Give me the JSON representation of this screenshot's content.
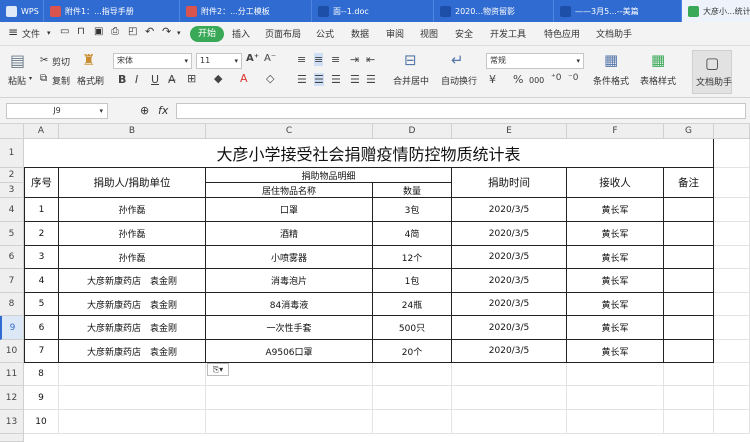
{
  "tabs": [
    {
      "label": "WPS",
      "color": "#ffffff"
    },
    {
      "label": "附件1：...指导手册",
      "color": "#d9534f"
    },
    {
      "label": "附件2：...分工模板",
      "color": "#d9534f"
    },
    {
      "label": "面--1.doc",
      "color": "#2f6bd0"
    },
    {
      "label": "2020...物资留影",
      "color": "#2f6bd0"
    },
    {
      "label": "——3月5...--美篇",
      "color": "#2f6bd0"
    },
    {
      "label": "大彦小...统计",
      "color": "#3aa957"
    }
  ],
  "menu": {
    "file": "文件",
    "items": [
      "开始",
      "插入",
      "页面布局",
      "公式",
      "数据",
      "审阅",
      "视图",
      "安全",
      "开发工具",
      "特色应用",
      "文档助手"
    ]
  },
  "toolbar": {
    "paste": "粘贴",
    "cut": "剪切",
    "copy": "复制",
    "format_painter": "格式刷",
    "font_name": "宋体",
    "font_size": "11",
    "merge_center": "合并居中",
    "wrap_text": "自动换行",
    "number_format": "常规",
    "percent": "%",
    "thousands": "000",
    "conditional_format": "条件格式",
    "table_style": "表格样式",
    "doc_assistant": "文档助手"
  },
  "formula_bar": {
    "cell_ref": "J9",
    "fx": "fx",
    "value": ""
  },
  "columns": [
    "A",
    "B",
    "C",
    "D",
    "E",
    "F",
    "G"
  ],
  "rows": [
    "1",
    "2",
    "3",
    "4",
    "5",
    "6",
    "7",
    "8",
    "9",
    "10",
    "11",
    "12",
    "13"
  ],
  "selected_row": "9",
  "sheet": {
    "title": "大彦小学接受社会捐赠疫情防控物质统计表",
    "h_no": "序号",
    "h_donor": "捐助人/捐助单位",
    "h_detail": "捐助物品明细",
    "h_item": "居住物品名称",
    "h_qty": "数量",
    "h_time": "捐助时间",
    "h_receiver": "接收人",
    "h_note": "备注",
    "data": [
      [
        "1",
        "孙作磊",
        "口罩",
        "3包",
        "2020/3/5",
        "黄长军"
      ],
      [
        "2",
        "孙作磊",
        "酒精",
        "4简",
        "2020/3/5",
        "黄长军"
      ],
      [
        "3",
        "孙作磊",
        "小喷雾器",
        "12个",
        "2020/3/5",
        "黄长军"
      ],
      [
        "4",
        "大彦新康药店　袁金刚",
        "消毒泡片",
        "1包",
        "2020/3/5",
        "黄长军"
      ],
      [
        "5",
        "大彦新康药店　袁金刚",
        "84消毒液",
        "24瓶",
        "2020/3/5",
        "黄长军"
      ],
      [
        "6",
        "大彦新康药店　袁金刚",
        "一次性手套",
        "500只",
        "2020/3/5",
        "黄长军"
      ],
      [
        "7",
        "大彦新康药店　袁金刚",
        "A9506口罩",
        "20个",
        "2020/3/5",
        "黄长军"
      ]
    ],
    "extra_rows": [
      "8",
      "9",
      "10"
    ]
  }
}
